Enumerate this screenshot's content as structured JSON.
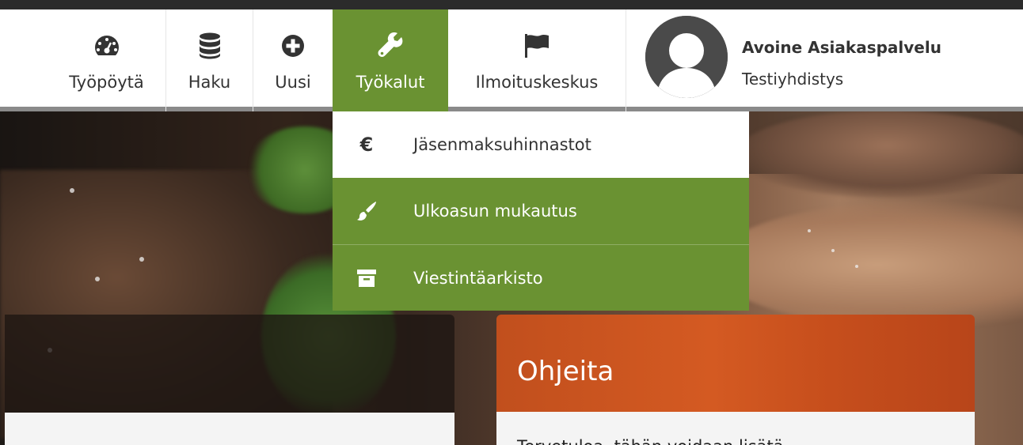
{
  "nav": {
    "items": [
      {
        "label": "Työpöytä",
        "icon": "dashboard-gauge-icon"
      },
      {
        "label": "Haku",
        "icon": "database-icon"
      },
      {
        "label": "Uusi",
        "icon": "plus-circle-icon"
      },
      {
        "label": "Työkalut",
        "icon": "wrench-icon",
        "active": true
      },
      {
        "label": "Ilmoituskeskus",
        "icon": "flag-icon"
      }
    ],
    "user": {
      "name": "Avoine Asiakaspalvelu",
      "org": "Testiyhdistys",
      "avatar_icon": "user-avatar-icon"
    }
  },
  "tools_menu": {
    "items": [
      {
        "label": "Jäsenmaksuhinnastot",
        "icon": "euro-icon"
      },
      {
        "label": "Ulkoasun mukautus",
        "icon": "paint-brush-icon"
      },
      {
        "label": "Viestintäarkisto",
        "icon": "archive-box-icon"
      }
    ]
  },
  "help_panel": {
    "title": "Ohjeita",
    "body_text": "Tervetuloa, tähän voidaan lisätä"
  },
  "colors": {
    "accent_green": "#6a9232",
    "help_orange": "#c85020",
    "nav_text": "#333333"
  }
}
